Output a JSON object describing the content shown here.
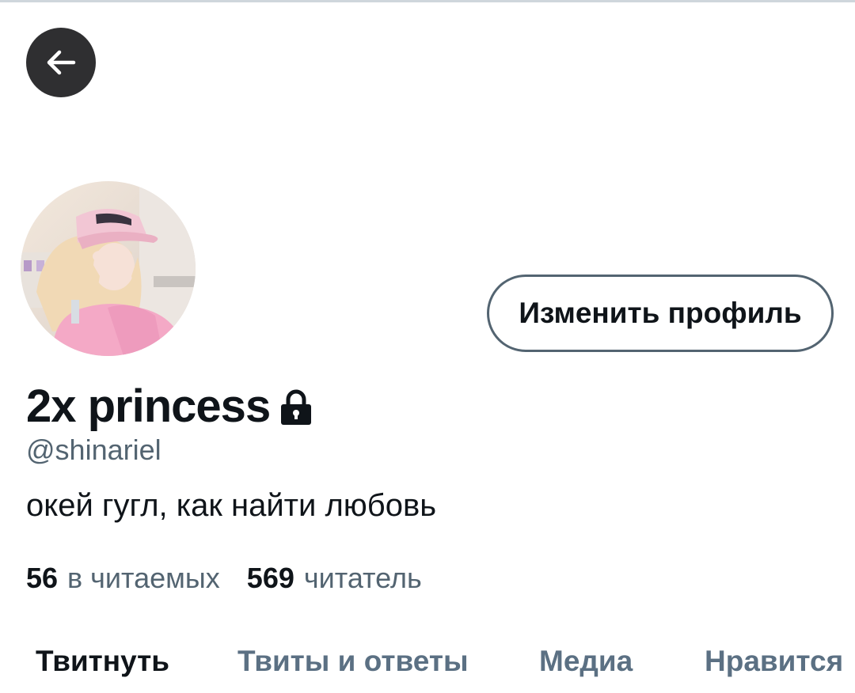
{
  "header": {
    "back_icon": "arrow-left-icon"
  },
  "profile": {
    "display_name": "2x princess",
    "protected_icon": "lock-icon",
    "handle": "@shinariel",
    "bio": "окей гугл, как найти любовь",
    "edit_button_label": "Изменить профиль",
    "stats": {
      "following_count": "56",
      "following_label": "в читаемых",
      "followers_count": "569",
      "followers_label": "читатель"
    }
  },
  "tabs": [
    {
      "label": "Твитнуть",
      "active": true
    },
    {
      "label": "Твиты и ответы",
      "active": false
    },
    {
      "label": "Медиа",
      "active": false
    },
    {
      "label": "Нравится",
      "active": false
    }
  ],
  "colors": {
    "text_primary": "#0f1419",
    "text_secondary": "#536471",
    "tab_inactive": "#5b7083",
    "back_button_bg": "#2f2f31"
  }
}
